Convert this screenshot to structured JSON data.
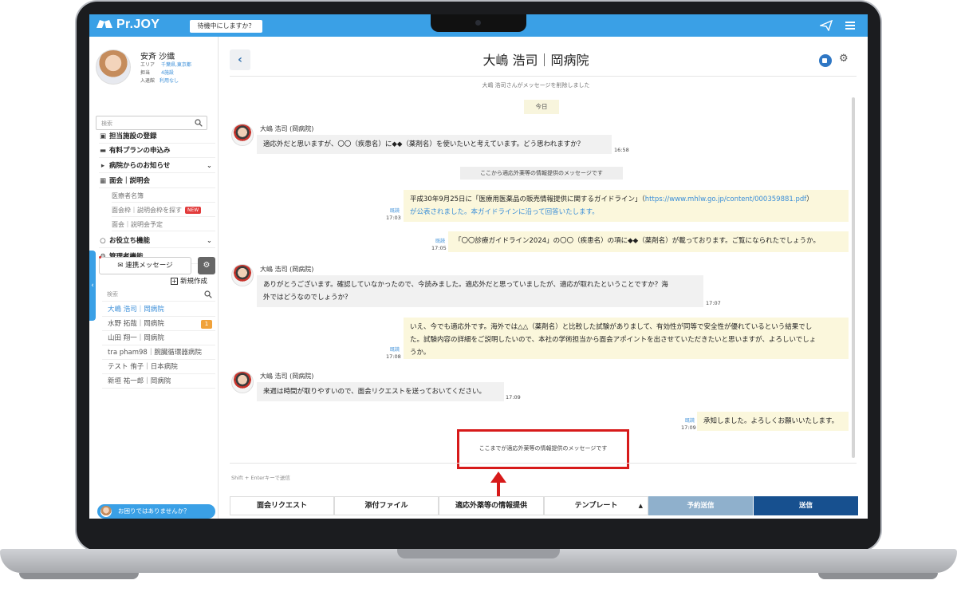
{
  "app": {
    "logo": "Pr.JOY",
    "status_button": "待機中にしますか？",
    "brand_color": "#3aa0e6"
  },
  "profile": {
    "name": "安斉 沙織",
    "area_label": "エリア",
    "area_value": "千葉県,東京都",
    "role_label": "担当",
    "role_value": "4施設",
    "entry_label": "入退館",
    "entry_value": "利用なし"
  },
  "sidebar": {
    "search_placeholder": "検索",
    "nav": [
      {
        "icon": "hospital-icon",
        "label": "担当施設の登録"
      },
      {
        "icon": "card-icon",
        "label": "有料プランの申込み"
      },
      {
        "icon": "megaphone-icon",
        "label": "病院からのお知らせ"
      },
      {
        "icon": "calendar-icon",
        "label": "面会｜説明会"
      },
      {
        "icon": "lightbulb-icon",
        "label": "お役立ち機能"
      },
      {
        "icon": "gears-icon",
        "label": "管理者機能"
      }
    ],
    "sub": [
      "医療者名簿",
      "面会枠｜説明会枠を探す",
      "面会｜説明会予定"
    ],
    "new_badge": "NEW",
    "message_button": "連携メッセージ",
    "new_create": "新規作成",
    "contact_search_placeholder": "検索",
    "contacts": [
      {
        "name": "大嶋 浩司｜岡病院",
        "unread": ""
      },
      {
        "name": "水野 拓哉｜岡病院",
        "unread": "1"
      },
      {
        "name": "山田 翔一｜岡病院",
        "unread": ""
      },
      {
        "name": "tra pham98｜腕臓循環器病院",
        "unread": ""
      },
      {
        "name": "テスト 侑子｜日本病院",
        "unread": ""
      },
      {
        "name": "新垣 祐一郎｜岡病院",
        "unread": ""
      }
    ],
    "help": "お困りではありませんか？"
  },
  "chat": {
    "title": "大嶋 浩司｜岡病院",
    "deleted_notice": "大嶋 浩司さんがメッセージを削除しました",
    "today": "今日",
    "sender": "大嶋 浩司 (岡病院)",
    "read_label": "既読",
    "messages": [
      {
        "text": "適応外だと思いますが、〇〇（疾患名）に◆◆（薬剤名）を使いたいと考えています。どう思われますか？",
        "time": "16:58"
      },
      {
        "text": "ここから適応外薬等の情報提供のメッセージです"
      },
      {
        "text_1": "平成30年9月25日に「医療用医薬品の販売情報提供に関するガイドライン」（",
        "link": "https://www.mhlw.go.jp/content/000359881.pdf",
        "text_2": "）",
        "text_3": "が公表されました。本ガイドラインに沿って回答いたします。",
        "time": "17:03"
      },
      {
        "text": "「〇〇診療ガイドライン2024」の〇〇（疾患名）の項に◆◆（薬剤名）が載っております。ご覧になられたでしょうか。",
        "time": "17:05"
      },
      {
        "text_1": "ありがとうございます。確認していなかったので、今読みました。適応外だと思っていましたが、適応が取れたということですか？海",
        "text_2": "外ではどうなのでしょうか？",
        "time": "17:07"
      },
      {
        "text_1": "いえ、今でも適応外です。海外では△△（薬剤名）と比較した試験がありまして、有効性が同等で安全性が優れているという結果でし",
        "text_2": "た。試験内容の詳細をご説明したいので、本社の学術担当から面会アポイントを出させていただきたいと思いますが、よろしいでしょ",
        "text_3": "うか。",
        "time": "17:08"
      },
      {
        "text": "来週は時間が取りやすいので、面会リクエストを送っておいてください。",
        "time": "17:09"
      },
      {
        "text": "承知しました。よろしくお願いいたします。",
        "time": "17:09"
      },
      {
        "text": "ここまでが適応外薬等の情報提供のメッセージです"
      }
    ],
    "compose_placeholder": "Shift + Enterキーで送信",
    "toolbar": {
      "meeting_request": "面会リクエスト",
      "attach_file": "添付ファイル",
      "offlabel_info": "適応外薬等の情報提供",
      "template": "テンプレート",
      "schedule_send": "予約送信",
      "send": "送信"
    },
    "highlight_color": "#d71a1a"
  }
}
